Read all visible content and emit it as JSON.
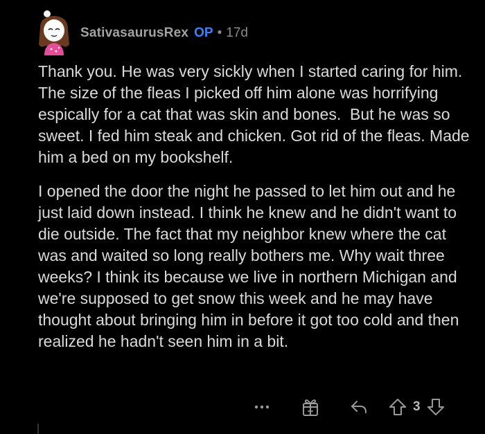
{
  "comment": {
    "username": "SativasaurusRex",
    "op_badge": "OP",
    "separator": "•",
    "age": "17d",
    "paragraphs": [
      "Thank you. He was very sickly when I started caring for him. The size of the fleas I picked off him alone was horrifying espically for a cat that was skin and bones.  But he was so sweet. I fed him steak and chicken. Got rid of the fleas. Made him a bed on my bookshelf.",
      "I opened the door the night he passed to let him out and he just laid down instead. I think he knew and he didn't want to die outside. The fact that my neighbor knew where the cat was and waited so long really bothers me. Why wait three weeks? I think its because we live in northern Michigan and we're supposed to get snow this week and he may have thought about bringing him in before it got too cold and then realized he hadn't seen him in a bit."
    ],
    "score": "3"
  },
  "actions": {
    "more_label": "•••",
    "icons": [
      "more-icon",
      "award-icon",
      "reply-icon",
      "upvote-icon",
      "downvote-icon"
    ]
  },
  "colors": {
    "background": "#000000",
    "text": "#dadada",
    "username": "#a3a3a3",
    "op_badge": "#3b82f6",
    "muted": "#8a8a8a"
  }
}
